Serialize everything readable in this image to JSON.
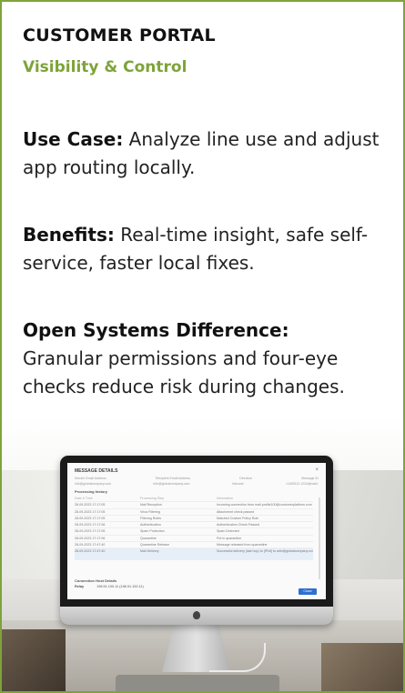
{
  "card": {
    "heading": "CUSTOMER PORTAL",
    "subheading": "Visibility & Control",
    "use_case_label": "Use Case:",
    "use_case_text": " Analyze line use and adjust app routing locally.",
    "benefits_label": "Benefits:",
    "benefits_text": " Real-time insight, safe self-service, faster local fixes.",
    "difference_label": "Open Systems Difference:",
    "difference_text": "Granular permissions and four-eye checks reduce risk during changes."
  },
  "colors": {
    "accent": "#7ea33a",
    "heading": "#111111",
    "body_text": "#222222"
  },
  "screen": {
    "title": "MESSAGE DETAILS",
    "close_glyph": "×",
    "info_rows": [
      [
        "Sender Email Address",
        "Recipient Email Address",
        "Direction",
        "Message ID"
      ],
      [
        "info@globalcompany.com",
        "info@globalcompany.com",
        "Inbound",
        "<1625112.1234@mail>"
      ]
    ],
    "section_processing": "Processing history",
    "table_header": [
      "Date & Time",
      "Processing Step",
      "Information"
    ],
    "table_rows": [
      [
        "28-09-2023 17:17:05",
        "Mail Reception",
        "Incoming connection from mail.profile100@customerplatform.com"
      ],
      [
        "28-09-2023 17:17:05",
        "Virus Filtering",
        "Attachment check passed"
      ],
      [
        "28-09-2023 17:17:05",
        "Filtering Rules",
        "Matched Custom Policy Rule"
      ],
      [
        "28-09-2023 17:17:06",
        "Authentication",
        "Authentication Check Passed"
      ],
      [
        "28-09-2023 17:17:05",
        "Spam Protection",
        "Spam Detected"
      ],
      [
        "28-09-2023 17:17:06",
        "Quarantine",
        "Put in quarantine"
      ],
      [
        "28-09-2023 17:47:40",
        "Quarantine Release",
        "Message released from quarantine"
      ],
      [
        "28-09-2023 17:47:40",
        "Mail Delivery",
        "Successful delivery (last hop) to [IPv6] to web@globalcompany.com"
      ]
    ],
    "section_connection": "Connection Host Details",
    "relay_label": "Relay",
    "relay_value": "198.51.100.11 (198.51.100.11)",
    "button_label": "Close"
  }
}
